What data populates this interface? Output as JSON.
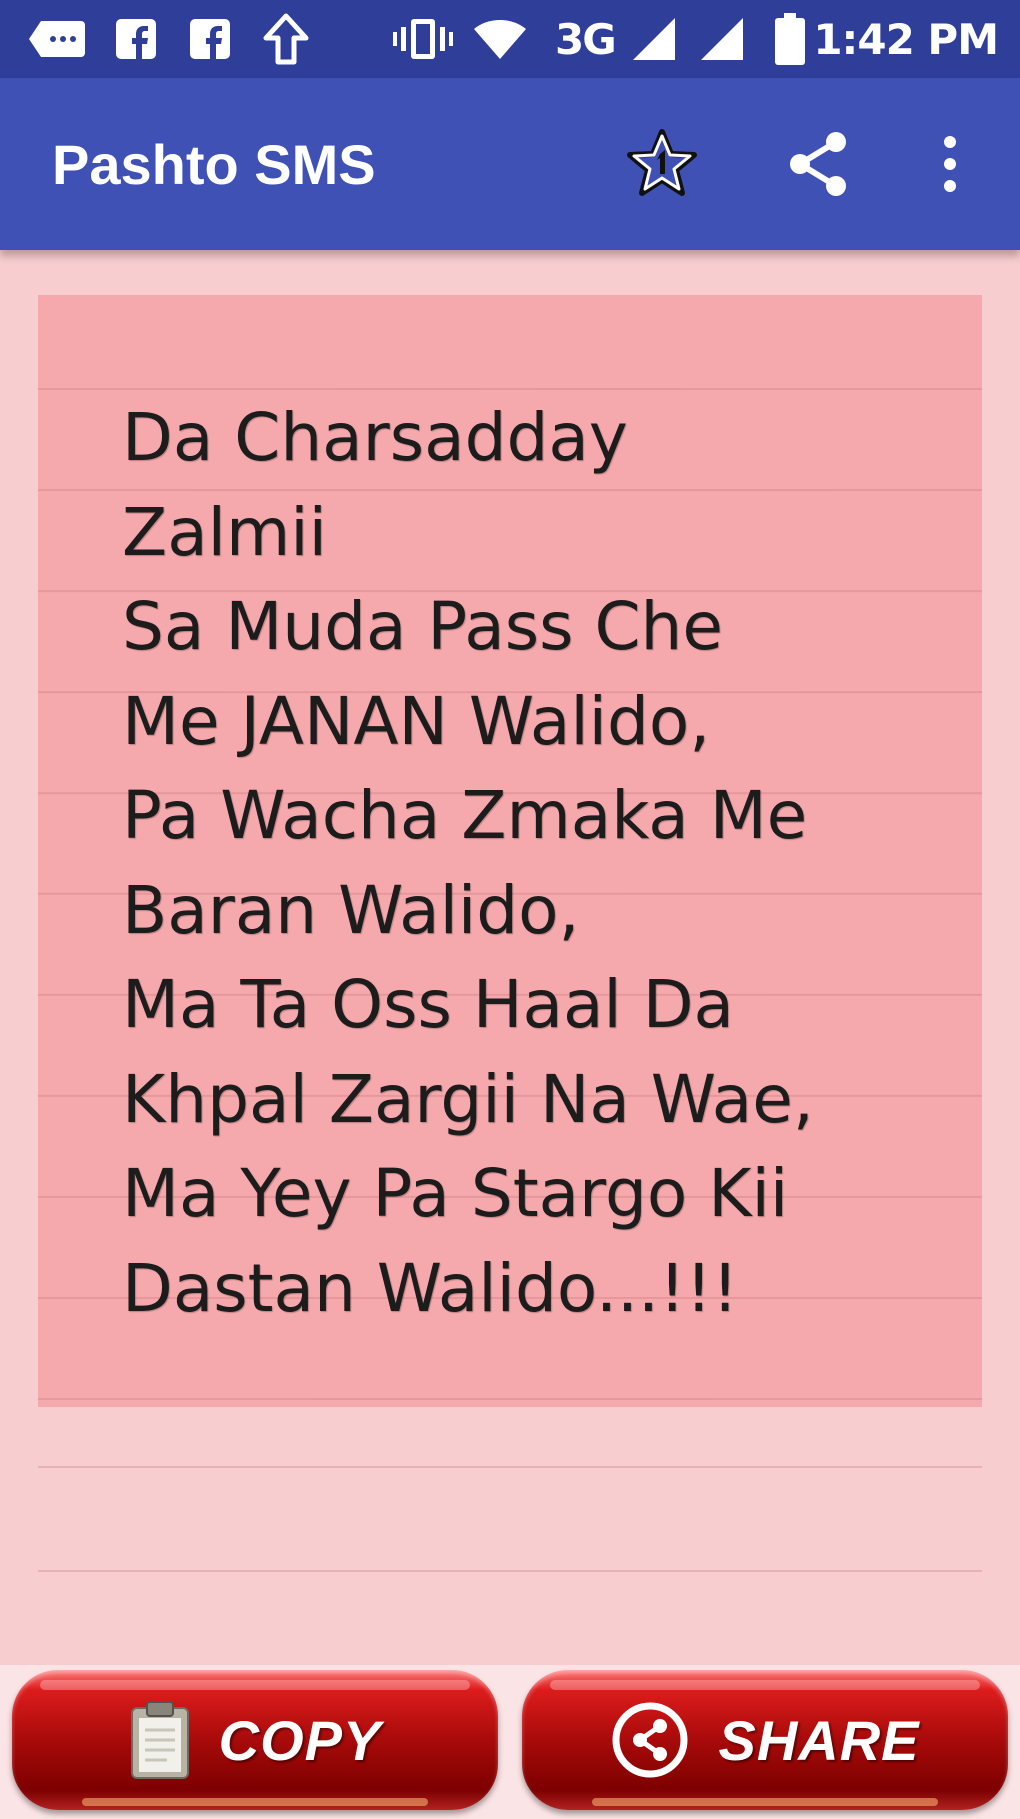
{
  "status_bar": {
    "time": "1:42 PM",
    "network": "3G",
    "icons": [
      "message-icon",
      "facebook-icon",
      "facebook-icon",
      "upload-arrow-icon",
      "vibrate-icon",
      "wifi-icon",
      "signal-icon",
      "signal-icon",
      "battery-icon"
    ]
  },
  "app_bar": {
    "title": "Pashto SMS",
    "actions": [
      "rate-star-icon",
      "share-icon",
      "overflow-menu-icon"
    ]
  },
  "note": {
    "text": "Da Charsadday\nZalmii\nSa Muda Pass Che\nMe JANAN Walido,\nPa Wacha Zmaka Me\nBaran Walido,\nMa Ta Oss Haal Da\nKhpal Zargii Na Wae,\nMa Yey Pa Stargo Kii\nDastan Walido...!!!"
  },
  "buttons": {
    "copy_label": "COPY",
    "share_label": "SHARE"
  },
  "colors": {
    "status_bar": "#2f3e99",
    "app_bar": "#3f51b5",
    "page_background": "#f8cdd0",
    "note_card": "#f6a9ac",
    "button_red": "#b30f0f"
  }
}
